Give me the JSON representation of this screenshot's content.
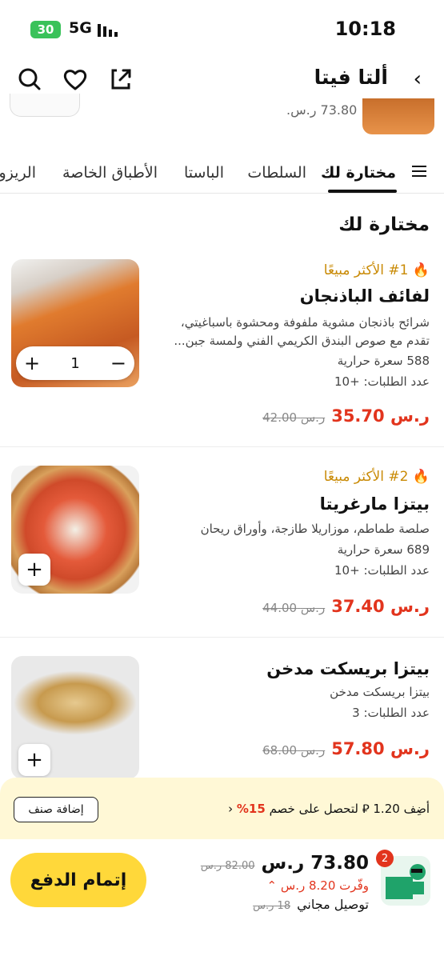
{
  "status": {
    "battery": "30",
    "network": "5G",
    "time": "10:18"
  },
  "header": {
    "title": "ألتا فيتا",
    "back": "‹"
  },
  "peek": {
    "price": "73.80 ر.س."
  },
  "tabs": [
    "مختارة لك",
    "السلطات",
    "الباستا",
    "الأطباق الخاصة",
    "الريزوتو"
  ],
  "section": {
    "title": "مختارة لك"
  },
  "currency": "ر.س",
  "items": [
    {
      "badge": "🔥 ‎#1 الأكثر مبيعًا",
      "name": "لفائف الباذنجان",
      "desc1": "شرائح باذنجان مشوية ملفوفة ومحشوة باسباغيتي،",
      "desc2": "تقدم مع صوص البندق الكريمي الفني ولمسة جبن...",
      "calories": "588 سعرة حرارية",
      "orders": "عدد الطلبات: +10",
      "price": "35.70",
      "old_price": "42.00",
      "qty": "1"
    },
    {
      "badge": "🔥 ‎#2 الأكثر مبيعًا",
      "name": "بيتزا مارغريتا",
      "desc1": "صلصة طماطم، موزاريلا طازجة، وأوراق ريحان",
      "calories": "689 سعرة حرارية",
      "orders": "عدد الطلبات: +10",
      "price": "37.40",
      "old_price": "44.00"
    },
    {
      "name": "بيتزا بريسكت مدخن",
      "desc1": "بيتزا بريسكت مدخن",
      "orders": "عدد الطلبات: 3",
      "price": "57.80",
      "old_price": "68.00"
    }
  ],
  "promo": {
    "text_prefix": "أضِف 1.20 ⃁ لتحصل على خصم ",
    "pct": "15%",
    "add_label": "إضافة صنف"
  },
  "checkout": {
    "total": "73.80",
    "old_total": "82.00",
    "saved": "وفّرت 8.20",
    "delivery": "توصيل مجاني",
    "delivery_old": "18",
    "pay_label": "إتمام الدفع",
    "cart_count": "2"
  },
  "colors": {
    "accent": "#ffd83a",
    "price": "#e2341d",
    "badge": "#c98a05"
  }
}
